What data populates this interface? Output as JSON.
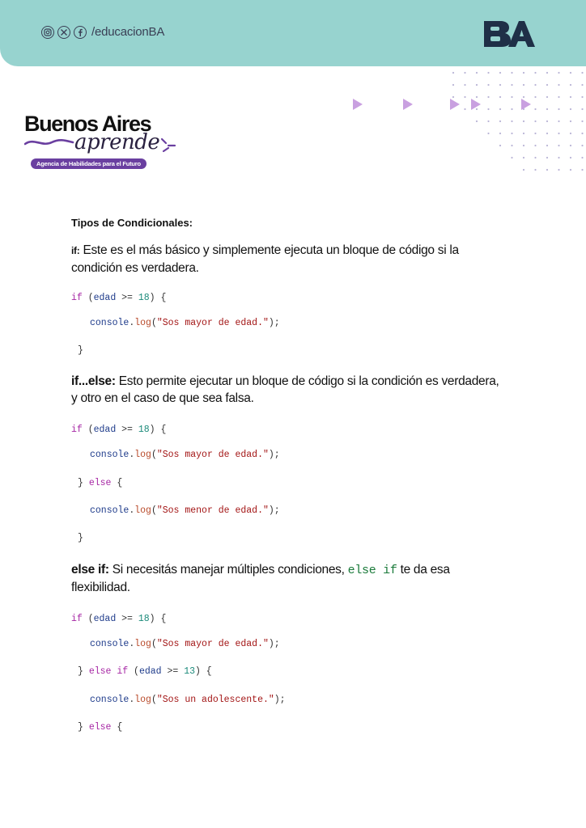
{
  "header": {
    "handle": "/educacionBA",
    "social_icons": [
      "instagram-icon",
      "x-icon",
      "facebook-icon"
    ],
    "logo_text": "BA",
    "bg_color": "#97d3cf"
  },
  "brand": {
    "title": "Buenos Aires",
    "script": "aprende",
    "tagline": "Agencia de Habilidades para el Futuro",
    "accent": "#6a3fa0"
  },
  "doc": {
    "section_title": "Tipos de Condicionales:",
    "if_label": "if:",
    "if_text": " Este es el más básico y simplemente ejecuta un bloque de código si la condición es verdadera.",
    "ifelse_label": "if...else:",
    "ifelse_text": " Esto permite ejecutar un bloque de código si la condición es verdadera, y otro en el caso de que sea falsa.",
    "elseif_label": "else if:",
    "elseif_text_a": " Si necesitás manejar múltiples condiciones, ",
    "elseif_code": "else if",
    "elseif_text_b": " te da esa flexibilidad."
  },
  "code": {
    "kw_if": "if",
    "kw_else": "else",
    "var": "edad",
    "op": ">=",
    "num_18": "18",
    "num_13": "13",
    "console": "console",
    "log": "log",
    "str_mayor": "\"Sos mayor de edad.\"",
    "str_menor": "\"Sos menor de edad.\"",
    "str_adol": "\"Sos un adolescente.\""
  }
}
